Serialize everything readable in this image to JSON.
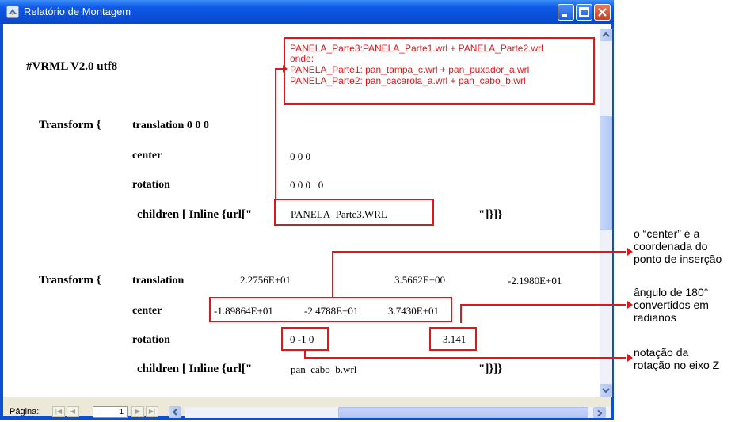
{
  "window": {
    "title": "Relatório de Montagem"
  },
  "document": {
    "vrml_header": "#VRML V2.0 utf8",
    "block1": {
      "transform_label": "Transform {",
      "translation_label": "translation 0 0 0",
      "center_label": "center",
      "center_value": "0 0 0",
      "rotation_label": "rotation",
      "rotation_value": "0 0 0   0",
      "children_label": "children [ Inline {url[\"",
      "children_value": "PANELA_Parte3.WRL",
      "children_close": "\"]}]}"
    },
    "block2": {
      "transform_label": "Transform {",
      "translation_label": "translation",
      "translation_x": "2.2756E+01",
      "translation_y": "3.5662E+00",
      "translation_z": "-2.1980E+01",
      "center_label": "center",
      "center_x": "-1.89864E+01",
      "center_y": "-2.4788E+01",
      "center_z": "3.7430E+01",
      "rotation_label": "rotation",
      "rotation_axis": "0 -1 0",
      "rotation_angle": "3.141",
      "children_label": "children [ Inline {url[\"",
      "children_value": "pan_cabo_b.wrl",
      "children_close": "\"]}]}"
    }
  },
  "annotations": {
    "composition_box": [
      "PANELA_Parte3:PANELA_Parte1.wrl + PANELA_Parte2.wrl",
      "onde:",
      "PANELA_Parte1: pan_tampa_c.wrl + pan_puxador_a.wrl",
      "PANELA_Parte2: pan_cacarola_a.wrl + pan_cabo_b.wrl"
    ],
    "center_note": [
      "o “center” é a",
      "coordenada do",
      "ponto de inserção"
    ],
    "angle_note": [
      "ângulo de 180°",
      "convertidos em",
      "radianos"
    ],
    "rotation_note": [
      "notação da",
      "rotação no eixo Z"
    ]
  },
  "pager": {
    "label": "Página:",
    "current_page": "1"
  },
  "colors": {
    "title_bar": "#0a50d5",
    "annotation_red": "#e0161a"
  }
}
